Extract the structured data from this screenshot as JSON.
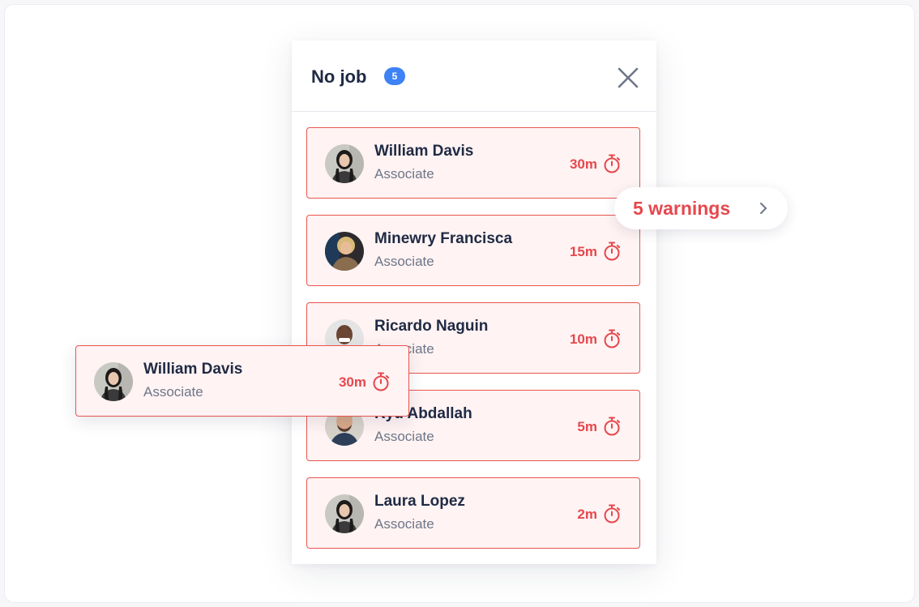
{
  "panel": {
    "title": "No job",
    "count": "5"
  },
  "warnings": {
    "label": "5 warnings"
  },
  "cards": [
    {
      "name": "William Davis",
      "role": "Associate",
      "time": "30m"
    },
    {
      "name": "Minewry Francisca",
      "role": "Associate",
      "time": "15m"
    },
    {
      "name": "Ricardo Naguin",
      "role": "Associate",
      "time": "10m"
    },
    {
      "name": "Kyu Abdallah",
      "role": "Associate",
      "time": "5m"
    },
    {
      "name": "Laura Lopez",
      "role": "Associate",
      "time": "2m"
    }
  ],
  "dragged_card": {
    "name": "William Davis",
    "role": "Associate",
    "time": "30m"
  },
  "colors": {
    "accent_red": "#e5484d",
    "card_border": "#e8554f",
    "card_bg": "#fff3f3",
    "badge_blue": "#3d82f6",
    "title": "#1f2a44",
    "subtitle": "#6e7688"
  },
  "icons": {
    "close": "close-icon",
    "timer": "stopwatch-icon",
    "chevron": "chevron-right-icon",
    "avatar": "avatar"
  }
}
